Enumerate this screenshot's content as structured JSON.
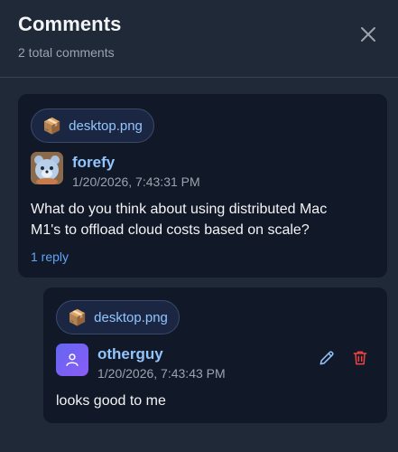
{
  "header": {
    "title": "Comments",
    "subtitle": "2 total comments",
    "close_icon": "close-icon"
  },
  "comments": [
    {
      "attachment": {
        "icon": "package-icon",
        "glyph": "📦",
        "filename": "desktop.png"
      },
      "author": "forefy",
      "timestamp": "1/20/2026, 7:43:31 PM",
      "avatar": "bear-avatar",
      "text_lines": [
        "What do you think about using distributed Mac",
        "M1's to offload cloud costs based on scale?"
      ],
      "reply_label": "1 reply"
    },
    {
      "attachment": {
        "icon": "package-icon",
        "glyph": "📦",
        "filename": "desktop.png"
      },
      "author": "otherguy",
      "timestamp": "1/20/2026, 7:43:43 PM",
      "avatar": "user-avatar",
      "text": "looks good to me",
      "actions": {
        "edit_icon": "pencil-icon",
        "delete_icon": "trash-icon"
      }
    }
  ],
  "colors": {
    "background": "#1f2937",
    "card": "#111827",
    "accent": "#93c5fd",
    "delete": "#ef4444"
  }
}
